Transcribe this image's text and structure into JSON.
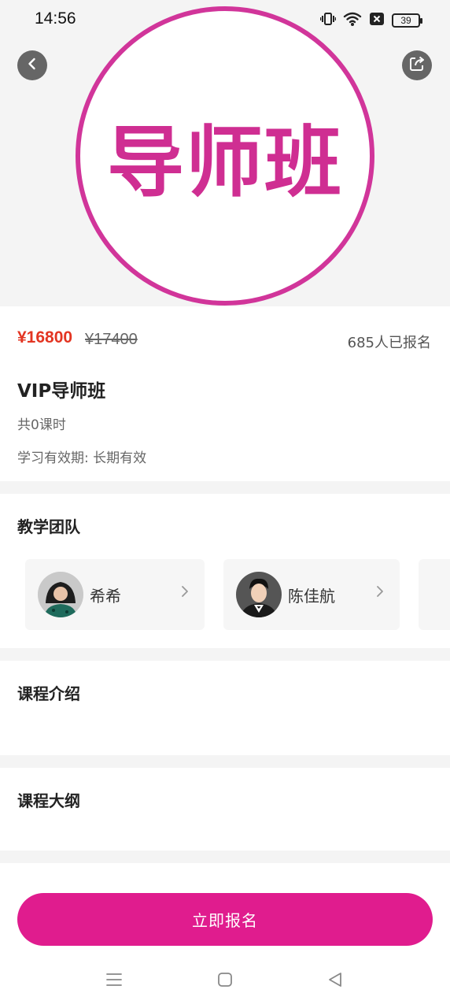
{
  "status_bar": {
    "time": "14:56",
    "battery": "39",
    "icons": [
      "vibrate-icon",
      "wifi-icon",
      "no-sim-icon",
      "battery-icon"
    ]
  },
  "hero": {
    "logo_text": "导师班",
    "accent_color": "#d1359a"
  },
  "header": {
    "back_icon": "chevron-left-icon",
    "share_icon": "share-icon"
  },
  "course": {
    "price": "¥16800",
    "original_price": "¥17400",
    "enrolled": "685人已报名",
    "title": "VIP导师班",
    "lessons": "共0课时",
    "validity": "学习有效期: 长期有效",
    "price_color": "#e33522"
  },
  "team": {
    "title": "教学团队",
    "teachers": [
      {
        "name": "希希"
      },
      {
        "name": "陈佳航"
      }
    ]
  },
  "intro": {
    "title": "课程介绍"
  },
  "outline": {
    "title": "课程大纲"
  },
  "cta": {
    "label": "立即报名",
    "color": "#e01c8e"
  },
  "nav": {
    "icons": [
      "menu-icon",
      "home-icon",
      "back-icon"
    ]
  }
}
